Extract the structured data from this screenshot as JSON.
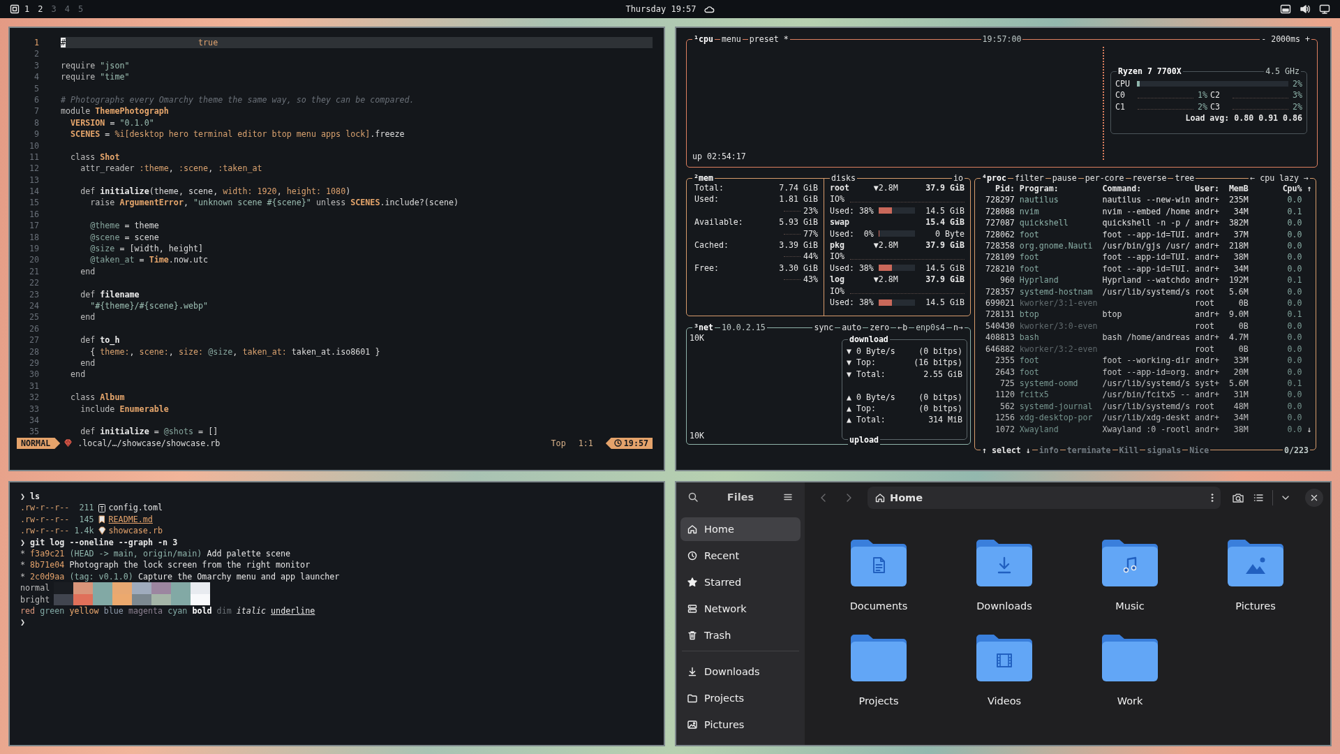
{
  "topbar": {
    "workspaces": [
      {
        "label": "1",
        "occupied": true
      },
      {
        "label": "2",
        "occupied": true
      },
      {
        "label": "3",
        "occupied": false
      },
      {
        "label": "4",
        "occupied": false
      },
      {
        "label": "5",
        "occupied": false
      }
    ],
    "clock": "Thursday 19:57"
  },
  "editor": {
    "lines": [
      {
        "number": "1",
        "current": true,
        "tokens": [
          {
            "kind": "cursor",
            "text": "#"
          }
        ],
        "hint": "true"
      },
      {
        "number": "2",
        "current": false
      },
      {
        "number": "3",
        "current": false,
        "tokens": [
          {
            "kind": "kw",
            "text": "require "
          },
          {
            "kind": "str",
            "text": "\"json\""
          }
        ]
      },
      {
        "number": "4",
        "current": false,
        "tokens": [
          {
            "kind": "kw",
            "text": "require "
          },
          {
            "kind": "str",
            "text": "\"time\""
          }
        ]
      },
      {
        "number": "5",
        "current": false
      },
      {
        "number": "6",
        "current": false,
        "tokens": [
          {
            "kind": "comment",
            "text": "# Photographs every Omarchy theme the same way, so they can be compared."
          }
        ]
      },
      {
        "number": "7",
        "current": false,
        "tokens": [
          {
            "kind": "kw",
            "text": "module "
          },
          {
            "kind": "const",
            "text": "ThemePhotograph"
          }
        ]
      },
      {
        "number": "8",
        "current": false,
        "tokens": [
          {
            "kind": "const",
            "text": "  VERSION"
          },
          {
            "kind": "plain",
            "text": " = "
          },
          {
            "kind": "str",
            "text": "\"0.1.0\""
          }
        ]
      },
      {
        "number": "9",
        "current": false,
        "tokens": [
          {
            "kind": "const",
            "text": "  SCENES"
          },
          {
            "kind": "plain",
            "text": " = "
          },
          {
            "kind": "sym",
            "text": "%i[desktop hero terminal editor btop menu apps lock]"
          },
          {
            "kind": "plain",
            "text": ".freeze"
          }
        ]
      },
      {
        "number": "10",
        "current": false
      },
      {
        "number": "11",
        "current": false,
        "tokens": [
          {
            "kind": "kw",
            "text": "  class "
          },
          {
            "kind": "const",
            "text": "Shot"
          }
        ]
      },
      {
        "number": "12",
        "current": false,
        "tokens": [
          {
            "kind": "kw",
            "text": "    attr_reader "
          },
          {
            "kind": "sym",
            "text": ":theme"
          },
          {
            "kind": "plain",
            "text": ", "
          },
          {
            "kind": "sym",
            "text": ":scene"
          },
          {
            "kind": "plain",
            "text": ", "
          },
          {
            "kind": "sym",
            "text": ":taken_at"
          }
        ]
      },
      {
        "number": "13",
        "current": false
      },
      {
        "number": "14",
        "current": false,
        "tokens": [
          {
            "kind": "kw",
            "text": "    def "
          },
          {
            "kind": "fn",
            "text": "initialize"
          },
          {
            "kind": "plain",
            "text": "(theme, scene, "
          },
          {
            "kind": "sym",
            "text": "width: "
          },
          {
            "kind": "num",
            "text": "1920"
          },
          {
            "kind": "plain",
            "text": ", "
          },
          {
            "kind": "sym",
            "text": "height: "
          },
          {
            "kind": "num",
            "text": "1080"
          },
          {
            "kind": "plain",
            "text": ")"
          }
        ]
      },
      {
        "number": "15",
        "current": false,
        "tokens": [
          {
            "kind": "kw",
            "text": "      raise "
          },
          {
            "kind": "const",
            "text": "ArgumentError"
          },
          {
            "kind": "plain",
            "text": ", "
          },
          {
            "kind": "str",
            "text": "\"unknown scene #{scene}\""
          },
          {
            "kind": "kw",
            "text": " unless "
          },
          {
            "kind": "const",
            "text": "SCENES"
          },
          {
            "kind": "plain",
            "text": ".include?(scene)"
          }
        ]
      },
      {
        "number": "16",
        "current": false
      },
      {
        "number": "17",
        "current": false,
        "tokens": [
          {
            "kind": "ivar",
            "text": "      @theme"
          },
          {
            "kind": "plain",
            "text": " = theme"
          }
        ]
      },
      {
        "number": "18",
        "current": false,
        "tokens": [
          {
            "kind": "ivar",
            "text": "      @scene"
          },
          {
            "kind": "plain",
            "text": " = scene"
          }
        ]
      },
      {
        "number": "19",
        "current": false,
        "tokens": [
          {
            "kind": "ivar",
            "text": "      @size"
          },
          {
            "kind": "plain",
            "text": " = [width, height]"
          }
        ]
      },
      {
        "number": "20",
        "current": false,
        "tokens": [
          {
            "kind": "ivar",
            "text": "      @taken_at"
          },
          {
            "kind": "plain",
            "text": " = "
          },
          {
            "kind": "const",
            "text": "Time"
          },
          {
            "kind": "plain",
            "text": ".now.utc"
          }
        ]
      },
      {
        "number": "21",
        "current": false,
        "tokens": [
          {
            "kind": "kw",
            "text": "    end"
          }
        ]
      },
      {
        "number": "22",
        "current": false
      },
      {
        "number": "23",
        "current": false,
        "tokens": [
          {
            "kind": "kw",
            "text": "    def "
          },
          {
            "kind": "fn",
            "text": "filename"
          }
        ]
      },
      {
        "number": "24",
        "current": false,
        "tokens": [
          {
            "kind": "str",
            "text": "      \"#{theme}/#{scene}.webp\""
          }
        ]
      },
      {
        "number": "25",
        "current": false,
        "tokens": [
          {
            "kind": "kw",
            "text": "    end"
          }
        ]
      },
      {
        "number": "26",
        "current": false
      },
      {
        "number": "27",
        "current": false,
        "tokens": [
          {
            "kind": "kw",
            "text": "    def "
          },
          {
            "kind": "fn",
            "text": "to_h"
          }
        ]
      },
      {
        "number": "28",
        "current": false,
        "tokens": [
          {
            "kind": "plain",
            "text": "      { "
          },
          {
            "kind": "sym",
            "text": "theme:"
          },
          {
            "kind": "plain",
            "text": ", "
          },
          {
            "kind": "sym",
            "text": "scene:"
          },
          {
            "kind": "plain",
            "text": ", "
          },
          {
            "kind": "sym",
            "text": "size: "
          },
          {
            "kind": "ivar",
            "text": "@size"
          },
          {
            "kind": "plain",
            "text": ", "
          },
          {
            "kind": "sym",
            "text": "taken_at:"
          },
          {
            "kind": "plain",
            "text": " taken_at.iso8601 }"
          }
        ]
      },
      {
        "number": "29",
        "current": false,
        "tokens": [
          {
            "kind": "kw",
            "text": "    end"
          }
        ]
      },
      {
        "number": "30",
        "current": false,
        "tokens": [
          {
            "kind": "kw",
            "text": "  end"
          }
        ]
      },
      {
        "number": "31",
        "current": false
      },
      {
        "number": "32",
        "current": false,
        "tokens": [
          {
            "kind": "kw",
            "text": "  class "
          },
          {
            "kind": "const",
            "text": "Album"
          }
        ]
      },
      {
        "number": "33",
        "current": false,
        "tokens": [
          {
            "kind": "kw",
            "text": "    include "
          },
          {
            "kind": "const",
            "text": "Enumerable"
          }
        ]
      },
      {
        "number": "34",
        "current": false
      },
      {
        "number": "35",
        "current": false,
        "tokens": [
          {
            "kind": "kw",
            "text": "    def "
          },
          {
            "kind": "fn",
            "text": "initialize"
          },
          {
            "kind": "plain",
            "text": " = "
          },
          {
            "kind": "ivar",
            "text": "@shots"
          },
          {
            "kind": "plain",
            "text": " = []"
          }
        ]
      }
    ],
    "status": {
      "mode": "NORMAL",
      "path": ".local/…/showcase/showcase.rb",
      "scroll": "Top",
      "position": "1:1",
      "time": "19:57"
    }
  },
  "btop": {
    "cpu": {
      "titles": {
        "left": [
          {
            "text": "¹cpu",
            "kind": "title"
          },
          {
            "text": "menu",
            "kind": "option"
          },
          {
            "text": "preset *",
            "kind": "option"
          }
        ],
        "center": [
          {
            "text": "19:57:00",
            "kind": "info"
          }
        ],
        "right": [
          {
            "text": "- 2000ms +",
            "kind": "option"
          }
        ]
      },
      "uptime": "up 02:54:17",
      "panel_titles": {
        "left": [
          {
            "text": "Ryzen 7 7700X",
            "kind": "title"
          }
        ],
        "right": [
          {
            "text": "4.5 GHz",
            "kind": "info"
          }
        ]
      },
      "total": {
        "label": "CPU",
        "level": 0.02,
        "percent": "2%"
      },
      "cores": [
        {
          "label": "C0",
          "percent": "1%"
        },
        {
          "label": "C2",
          "percent": "3%"
        },
        {
          "label": "C1",
          "percent": "2%"
        },
        {
          "label": "C3",
          "percent": "2%"
        }
      ],
      "load": "Load avg: 0.80 0.91 0.86"
    },
    "mem": {
      "titles": {
        "left": [
          {
            "text": "²mem",
            "kind": "title"
          }
        ]
      },
      "rows": [
        {
          "label": "Total:",
          "value": "7.74 GiB"
        },
        {
          "label": "Used:",
          "value": "1.81 GiB",
          "percent": "23%"
        },
        {
          "label": "Available:",
          "value": "5.93 GiB",
          "percent": "77%"
        },
        {
          "label": "Cached:",
          "value": "3.39 GiB",
          "percent": "44%"
        },
        {
          "label": "Free:",
          "value": "3.30 GiB",
          "percent": "43%"
        }
      ]
    },
    "disks": {
      "titles": {
        "left": [
          {
            "text": "disks",
            "kind": "option"
          }
        ],
        "right": [
          {
            "text": "io",
            "kind": "option"
          }
        ]
      },
      "items": [
        {
          "name": "root",
          "io": "▼2.8M",
          "total": "37.9 GiB",
          "io_label": "IO%",
          "used_label": "Used: 38%",
          "level": 0.38,
          "used": "14.5 GiB"
        },
        {
          "name": "swap",
          "total": "15.4 GiB",
          "used_label": "Used:  0%",
          "level": 0,
          "used": "0 Byte"
        },
        {
          "name": "pkg",
          "io": "▼2.8M",
          "total": "37.9 GiB",
          "io_label": "IO%",
          "used_label": "Used: 38%",
          "level": 0.38,
          "used": "14.5 GiB"
        },
        {
          "name": "log",
          "io": "▼2.8M",
          "total": "37.9 GiB",
          "io_label": "IO%",
          "used_label": "Used: 38%",
          "level": 0.38,
          "used": "14.5 GiB"
        }
      ]
    },
    "net": {
      "titles": {
        "left": [
          {
            "text": "³net",
            "kind": "title"
          },
          {
            "text": "10.0.2.15",
            "kind": "info"
          }
        ],
        "right": [
          {
            "text": "sync",
            "kind": "option"
          },
          {
            "text": "auto",
            "kind": "option"
          },
          {
            "text": "zero",
            "kind": "option"
          },
          {
            "text": "←b",
            "kind": "option"
          },
          {
            "text": "enp0s4",
            "kind": "info"
          },
          {
            "text": "n→",
            "kind": "option"
          }
        ]
      },
      "scale_top": "10K",
      "scale_bottom": "10K",
      "download": {
        "title": "download",
        "rows": [
          {
            "text": "▼ 0 Byte/s",
            "value": "(0 bitps)"
          },
          {
            "text": "▼ Top:",
            "value": "(16 bitps)"
          },
          {
            "text": "▼ Total:",
            "value": "2.55 GiB"
          }
        ]
      },
      "upload": {
        "title": "upload",
        "rows": [
          {
            "text": "▲ 0 Byte/s",
            "value": "(0 bitps)"
          },
          {
            "text": "▲ Top:",
            "value": "(0 bitps)"
          },
          {
            "text": "▲ Total:",
            "value": "314 MiB"
          }
        ]
      }
    },
    "proc": {
      "titles": {
        "left": [
          {
            "text": "⁴proc",
            "kind": "title"
          },
          {
            "text": "filter",
            "kind": "option"
          },
          {
            "text": "pause",
            "kind": "option"
          },
          {
            "text": "per-core",
            "kind": "option"
          },
          {
            "text": "reverse",
            "kind": "option"
          },
          {
            "text": "tree",
            "kind": "option"
          }
        ],
        "right": [
          {
            "text": "← cpu lazy →",
            "kind": "option"
          }
        ]
      },
      "columns": [
        "Pid:",
        "Program:",
        "Command:",
        "User:",
        "MemB",
        "Cpu%"
      ],
      "scroll_up": "↑",
      "scroll_down": "↓",
      "rows": [
        {
          "pid": "728297",
          "program": "nautilus",
          "command": "nautilus --new-win",
          "user": "andr+",
          "mem": "235M",
          "cpu": "0.0"
        },
        {
          "pid": "728088",
          "program": "nvim",
          "command": "nvim --embed /home",
          "user": "andr+",
          "mem": "34M",
          "cpu": "0.1"
        },
        {
          "pid": "727087",
          "program": "quickshell",
          "command": "quickshell -n -p /",
          "user": "andr+",
          "mem": "382M",
          "cpu": "0.0"
        },
        {
          "pid": "728062",
          "program": "foot",
          "command": "foot --app-id=TUI.",
          "user": "andr+",
          "mem": "37M",
          "cpu": "0.0"
        },
        {
          "pid": "728358",
          "program": "org.gnome.Nauti",
          "command": "/usr/bin/gjs /usr/",
          "user": "andr+",
          "mem": "218M",
          "cpu": "0.0"
        },
        {
          "pid": "728109",
          "program": "foot",
          "command": "foot --app-id=TUI.",
          "user": "andr+",
          "mem": "38M",
          "cpu": "0.0"
        },
        {
          "pid": "728210",
          "program": "foot",
          "command": "foot --app-id=TUI.",
          "user": "andr+",
          "mem": "34M",
          "cpu": "0.0"
        },
        {
          "pid": "960",
          "program": "Hyprland",
          "command": "Hyprland --watchdo",
          "user": "andr+",
          "mem": "192M",
          "cpu": "0.1"
        },
        {
          "pid": "728357",
          "program": "systemd-hostnam",
          "command": "/usr/lib/systemd/s",
          "user": "root",
          "mem": "5.6M",
          "cpu": "0.0"
        },
        {
          "pid": "699021",
          "program": "kworker/3:1-even",
          "user": "root",
          "mem": "0B",
          "cpu": "0.0"
        },
        {
          "pid": "728131",
          "program": "btop",
          "command": "btop",
          "user": "andr+",
          "mem": "9.0M",
          "cpu": "0.1"
        },
        {
          "pid": "540430",
          "program": "kworker/3:0-even",
          "user": "root",
          "mem": "0B",
          "cpu": "0.0"
        },
        {
          "pid": "408813",
          "program": "bash",
          "command": "bash /home/andreas",
          "user": "andr+",
          "mem": "4.7M",
          "cpu": "0.0"
        },
        {
          "pid": "646882",
          "program": "kworker/3:2-even",
          "user": "root",
          "mem": "0B",
          "cpu": "0.0"
        },
        {
          "pid": "2355",
          "program": "foot",
          "command": "foot --working-dir",
          "user": "andr+",
          "mem": "33M",
          "cpu": "0.0"
        },
        {
          "pid": "2643",
          "program": "foot",
          "command": "foot --app-id=org.",
          "user": "andr+",
          "mem": "20M",
          "cpu": "0.0"
        },
        {
          "pid": "725",
          "program": "systemd-oomd",
          "command": "/usr/lib/systemd/s",
          "user": "syst+",
          "mem": "5.6M",
          "cpu": "0.1"
        },
        {
          "pid": "1120",
          "program": "fcitx5",
          "command": "/usr/bin/fcitx5 --",
          "user": "andr+",
          "mem": "31M",
          "cpu": "0.0"
        },
        {
          "pid": "562",
          "program": "systemd-journal",
          "command": "/usr/lib/systemd/s",
          "user": "root",
          "mem": "48M",
          "cpu": "0.0"
        },
        {
          "pid": "1256",
          "program": "xdg-desktop-por",
          "command": "/usr/lib/xdg-deskt",
          "user": "andr+",
          "mem": "34M",
          "cpu": "0.0"
        },
        {
          "pid": "1072",
          "program": "Xwayland",
          "command": "Xwayland :0 -rootl",
          "user": "andr+",
          "mem": "38M",
          "cpu": "0.0"
        }
      ],
      "footer": {
        "left": [
          {
            "text": "↑ select ↓",
            "kind": "option",
            "disabled": false
          },
          {
            "text": "info",
            "kind": "option",
            "disabled": true
          },
          {
            "text": "terminate",
            "kind": "option",
            "disabled": true
          },
          {
            "text": "Kill",
            "kind": "option",
            "disabled": true
          },
          {
            "text": "signals",
            "kind": "option",
            "disabled": true
          },
          {
            "text": "Nice",
            "kind": "option",
            "disabled": true
          }
        ],
        "right": [
          {
            "text": "0/223",
            "kind": "info",
            "disabled": false
          }
        ]
      }
    }
  },
  "terminal": {
    "lines": [
      {
        "kind": "prompt",
        "symbol": "❯",
        "command": "ls"
      },
      {
        "kind": "toml-file",
        "perms": ".rw-r--r--",
        "size": "211",
        "name": "config.toml"
      },
      {
        "kind": "markdown-file",
        "perms": ".rw-r--r--",
        "size": "145",
        "name": "README.md"
      },
      {
        "kind": "ruby-file",
        "perms": ".rw-r--r--",
        "size": "1.4k",
        "name": "showcase.rb"
      },
      {
        "kind": "prompt",
        "symbol": "❯",
        "command": "git log --oneline --graph -n 3"
      },
      {
        "kind": "commit",
        "graph": "*",
        "hash": "f3a9c21",
        "refs": "(HEAD -> main, origin/main)",
        "message": "Add palette scene"
      },
      {
        "kind": "commit",
        "graph": "*",
        "hash": "8b71e04",
        "message": "Photograph the lock screen from the right monitor"
      },
      {
        "kind": "commit",
        "graph": "*",
        "hash": "2c0d9aa",
        "refs": "(tag: v0.1.0)",
        "message": "Capture the Omarchy menu and app launcher"
      },
      {
        "kind": "palette",
        "label": "normal",
        "swatches": [
          {
            "color": "#1a1d22"
          },
          {
            "color": "#d9957a"
          },
          {
            "color": "#82a9a5"
          },
          {
            "color": "#e8a872"
          },
          {
            "color": "#9fabbd"
          },
          {
            "color": "#9c86a0"
          },
          {
            "color": "#82a9a5"
          },
          {
            "color": "#e8ebf0"
          }
        ]
      },
      {
        "kind": "palette",
        "label": "bright",
        "swatches": [
          {
            "color": "#41454f"
          },
          {
            "color": "#e0705a"
          },
          {
            "color": "#82a9a5"
          },
          {
            "color": "#eca96e"
          },
          {
            "color": "#7c8890"
          },
          {
            "color": "#a5b5a8"
          },
          {
            "color": "#82a9a5"
          },
          {
            "color": "#f8f9fb"
          }
        ]
      },
      {
        "kind": "styles",
        "words": [
          {
            "text": "red",
            "kind": "color",
            "color": "#d9957a"
          },
          {
            "text": "green",
            "kind": "color",
            "color": "#82a9a5"
          },
          {
            "text": "yellow",
            "kind": "color",
            "color": "#eca96e"
          },
          {
            "text": "blue",
            "kind": "color",
            "color": "#8f9bab"
          },
          {
            "text": "magenta",
            "kind": "color",
            "color": "#8a7f8f"
          },
          {
            "text": "cyan",
            "kind": "color",
            "color": "#82a9a5"
          },
          {
            "text": "bold",
            "kind": "bold"
          },
          {
            "text": "dim",
            "kind": "dim"
          },
          {
            "text": "italic",
            "kind": "italic"
          },
          {
            "text": "underline",
            "kind": "underline"
          }
        ]
      },
      {
        "kind": "prompt",
        "symbol": "❯"
      }
    ]
  },
  "files": {
    "title": "Files",
    "places": [
      {
        "label": "Home",
        "kind": "home",
        "selected": true
      },
      {
        "label": "Recent",
        "kind": "recent",
        "selected": false
      },
      {
        "label": "Starred",
        "kind": "star",
        "selected": false
      },
      {
        "label": "Network",
        "kind": "network",
        "selected": false
      },
      {
        "label": "Trash",
        "kind": "trash",
        "selected": false
      }
    ],
    "bookmarks": [
      {
        "label": "Downloads",
        "kind": "download",
        "selected": false
      },
      {
        "label": "Projects",
        "kind": "folder",
        "selected": false
      },
      {
        "label": "Pictures",
        "kind": "image",
        "selected": false
      }
    ],
    "location": "Home",
    "folders": [
      {
        "name": "Documents",
        "kind": "document"
      },
      {
        "name": "Downloads",
        "kind": "download"
      },
      {
        "name": "Music",
        "kind": "music"
      },
      {
        "name": "Pictures",
        "kind": "picture"
      },
      {
        "name": "Projects",
        "kind": "plain"
      },
      {
        "name": "Videos",
        "kind": "video"
      },
      {
        "name": "Work",
        "kind": "plain"
      }
    ]
  }
}
